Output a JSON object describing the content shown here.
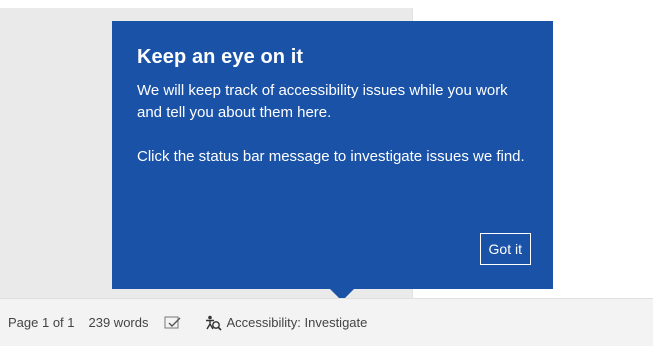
{
  "callout": {
    "title": "Keep an eye on it",
    "paragraph1": "We will keep track of accessibility issues while you work and tell you about them here.",
    "paragraph2": "Click the status bar message to investigate issues we find.",
    "button_label": "Got it"
  },
  "status_bar": {
    "page_count": "Page 1 of 1",
    "word_count": "239 words",
    "proofing_icon": "proofing-check-icon",
    "accessibility_icon": "accessibility-icon",
    "accessibility_label": "Accessibility: Investigate"
  },
  "colors": {
    "callout_background": "#1a52a8",
    "status_bar_background": "#f3f3f3",
    "canvas_background": "#eaeaea"
  }
}
